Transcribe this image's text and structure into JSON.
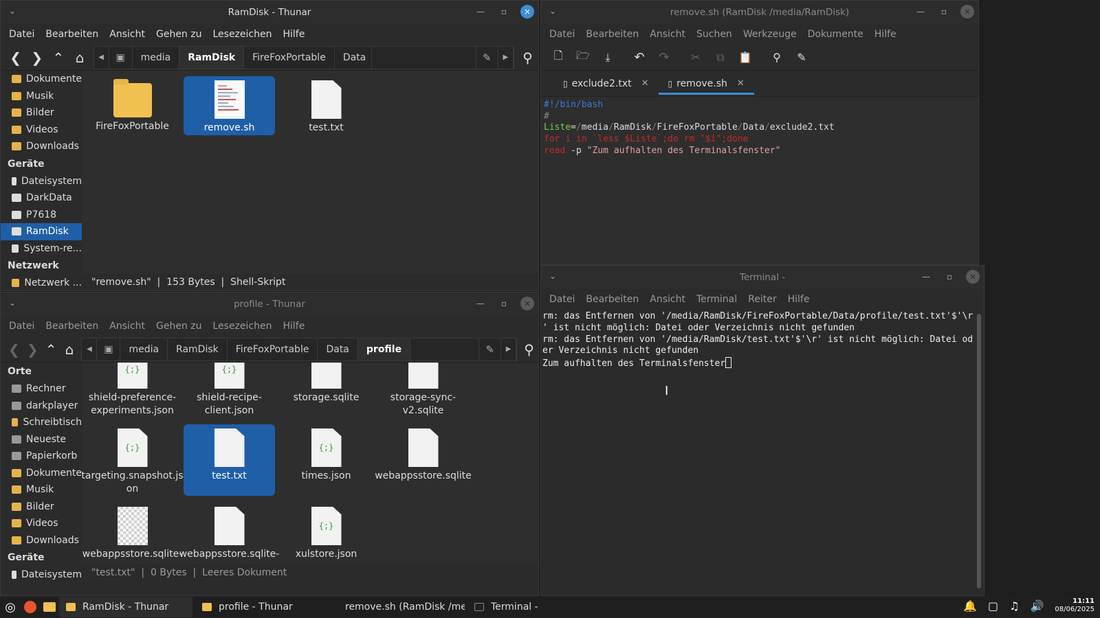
{
  "thunar_top": {
    "title": "RamDisk - Thunar",
    "menu": [
      "Datei",
      "Bearbeiten",
      "Ansicht",
      "Gehen zu",
      "Lesezeichen",
      "Hilfe"
    ],
    "path": [
      "media",
      "RamDisk",
      "FireFoxPortable",
      "Data"
    ],
    "sidebar": [
      {
        "type": "item",
        "label": "Dokumente",
        "icon": "folder-icon"
      },
      {
        "type": "item",
        "label": "Musik",
        "icon": "folder-icon"
      },
      {
        "type": "item",
        "label": "Bilder",
        "icon": "folder-icon"
      },
      {
        "type": "item",
        "label": "Videos",
        "icon": "folder-icon"
      },
      {
        "type": "item",
        "label": "Downloads",
        "icon": "folder-icon"
      },
      {
        "type": "head",
        "label": "Geräte"
      },
      {
        "type": "item",
        "label": "Dateisystem",
        "icon": "drive-icon"
      },
      {
        "type": "item",
        "label": "DarkData",
        "icon": "drive-icon"
      },
      {
        "type": "item",
        "label": "P7618",
        "icon": "drive-icon"
      },
      {
        "type": "item",
        "label": "RamDisk",
        "icon": "drive-icon",
        "selected": true
      },
      {
        "type": "item",
        "label": "System-re...",
        "icon": "drive-icon"
      },
      {
        "type": "head",
        "label": "Netzwerk"
      },
      {
        "type": "item",
        "label": "Netzwerk ...",
        "icon": "folder-icon"
      }
    ],
    "files": [
      {
        "name": "FireFoxPortable",
        "kind": "folder"
      },
      {
        "name": "remove.sh",
        "kind": "script",
        "selected": true
      },
      {
        "name": "test.txt",
        "kind": "doc"
      }
    ],
    "status": "\"remove.sh\"  |  153 Bytes  |  Shell-Skript"
  },
  "thunar_bottom": {
    "title": "profile - Thunar",
    "menu": [
      "Datei",
      "Bearbeiten",
      "Ansicht",
      "Gehen zu",
      "Lesezeichen",
      "Hilfe"
    ],
    "path": [
      "media",
      "RamDisk",
      "FireFoxPortable",
      "Data",
      "profile"
    ],
    "sidebar": [
      {
        "type": "head",
        "label": "Orte"
      },
      {
        "type": "item",
        "label": "Rechner",
        "icon": "computer-icon"
      },
      {
        "type": "item",
        "label": "darkplayer",
        "icon": "home-icon"
      },
      {
        "type": "item",
        "label": "Schreibtisch",
        "icon": "folder-icon"
      },
      {
        "type": "item",
        "label": "Neueste",
        "icon": "recent-icon"
      },
      {
        "type": "item",
        "label": "Papierkorb",
        "icon": "trash-icon"
      },
      {
        "type": "item",
        "label": "Dokumente",
        "icon": "folder-icon"
      },
      {
        "type": "item",
        "label": "Musik",
        "icon": "folder-icon"
      },
      {
        "type": "item",
        "label": "Bilder",
        "icon": "folder-icon"
      },
      {
        "type": "item",
        "label": "Videos",
        "icon": "folder-icon"
      },
      {
        "type": "item",
        "label": "Downloads",
        "icon": "folder-icon"
      },
      {
        "type": "head",
        "label": "Geräte"
      },
      {
        "type": "item",
        "label": "Dateisystem",
        "icon": "drive-icon"
      }
    ],
    "files": [
      {
        "name": "shield-preference-experiments.json",
        "lines": [
          "shield-preference-",
          "experiments.json"
        ],
        "kind": "json"
      },
      {
        "name": "shield-recipe-client.json",
        "lines": [
          "shield-recipe-",
          "client.json"
        ],
        "kind": "json"
      },
      {
        "name": "storage.sqlite",
        "lines": [
          "storage.sqlite"
        ],
        "kind": "doc"
      },
      {
        "name": "storage-sync-v2.sqlite",
        "lines": [
          "storage-sync-",
          "v2.sqlite"
        ],
        "kind": "doc"
      },
      {
        "name": "targeting.snapshot.json",
        "lines": [
          "targeting.snapshot.js",
          "on"
        ],
        "kind": "json"
      },
      {
        "name": "test.txt",
        "lines": [
          "test.txt"
        ],
        "kind": "doc",
        "selected": true
      },
      {
        "name": "times.json",
        "lines": [
          "times.json"
        ],
        "kind": "json"
      },
      {
        "name": "webappsstore.sqlite",
        "lines": [
          "webappsstore.sqlite"
        ],
        "kind": "doc"
      },
      {
        "name": "webappsstore.sqlite-",
        "lines": [
          "webappsstore.sqlite-"
        ],
        "kind": "image"
      },
      {
        "name": "webappsstore.sqlite-",
        "lines": [
          "webappsstore.sqlite-"
        ],
        "kind": "doc"
      },
      {
        "name": "xulstore.json",
        "lines": [
          "xulstore.json"
        ],
        "kind": "json"
      }
    ],
    "status": "\"test.txt\"  |  0 Bytes  |  Leeres Dokument"
  },
  "editor": {
    "title": "remove.sh (RamDisk /media/RamDisk)",
    "menu": [
      "Datei",
      "Bearbeiten",
      "Ansicht",
      "Suchen",
      "Werkzeuge",
      "Dokumente",
      "Hilfe"
    ],
    "tabs": [
      {
        "label": "exclude2.txt",
        "active": false
      },
      {
        "label": "remove.sh",
        "active": true
      }
    ],
    "lines": [
      [
        {
          "t": "#!/bin/bash",
          "c": "#3a7bd5"
        }
      ],
      [
        {
          "t": "#",
          "c": "#888"
        }
      ],
      [
        {
          "t": "Liste",
          "c": "#7ec850"
        },
        {
          "t": "=",
          "c": "#ddd"
        },
        {
          "t": "/",
          "c": "#777"
        },
        {
          "t": "media",
          "c": "#ddd"
        },
        {
          "t": "/",
          "c": "#777"
        },
        {
          "t": "RamDisk",
          "c": "#ddd"
        },
        {
          "t": "/",
          "c": "#777"
        },
        {
          "t": "FireFoxPortable",
          "c": "#ddd"
        },
        {
          "t": "/",
          "c": "#777"
        },
        {
          "t": "Data",
          "c": "#ddd"
        },
        {
          "t": "/",
          "c": "#777"
        },
        {
          "t": "exclude2.txt",
          "c": "#ddd"
        }
      ],
      [
        {
          "t": "for i in `less $Liste`;do rm \"$i\";done",
          "c": "#c02a2a"
        }
      ],
      [
        {
          "t": "read",
          "c": "#c02a2a"
        },
        {
          "t": " -p ",
          "c": "#ddd"
        },
        {
          "t": "\"Zum aufhalten des Terminalsfenster\"",
          "c": "#e0a0a0"
        }
      ]
    ]
  },
  "terminal": {
    "title": "Terminal -",
    "menu": [
      "Datei",
      "Bearbeiten",
      "Ansicht",
      "Terminal",
      "Reiter",
      "Hilfe"
    ],
    "lines": [
      "rm: das Entfernen von '/media/RamDisk/FireFoxPortable/Data/profile/test.txt'$'\\r",
      "' ist nicht möglich: Datei oder Verzeichnis nicht gefunden",
      "rm: das Entfernen von '/media/RamDisk/test.txt'$'\\r' ist nicht möglich: Datei od",
      "er Verzeichnis nicht gefunden",
      "Zum aufhalten des Terminalsfenster"
    ]
  },
  "taskbar": {
    "tasks": [
      {
        "label": "RamDisk - Thunar",
        "active": true
      },
      {
        "label": "profile - Thunar",
        "active": false
      },
      {
        "label": "remove.sh (RamDisk /me...",
        "active": false
      },
      {
        "label": "Terminal -",
        "active": false
      }
    ],
    "time": "11:11",
    "date": "08/06/2025"
  }
}
